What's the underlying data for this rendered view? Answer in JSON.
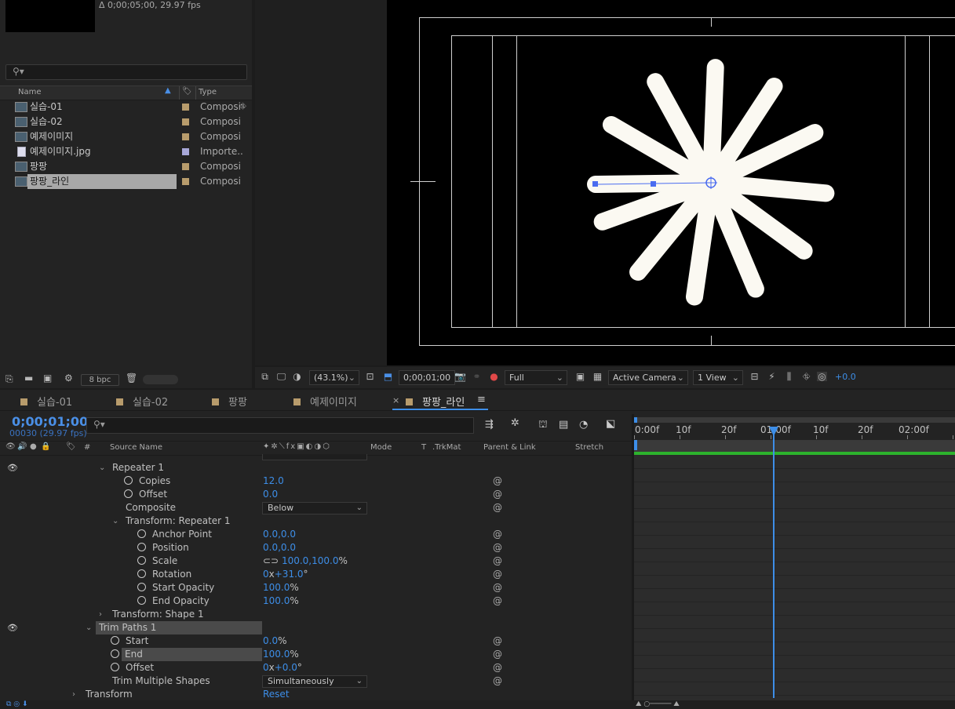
{
  "project": {
    "info": "Δ 0;00;05;00, 29.97 fps",
    "search_icon": "search-icon",
    "col_name": "Name",
    "col_type": "Type",
    "items": [
      {
        "name": "실습-01",
        "type": "Composi",
        "kind": "comp"
      },
      {
        "name": "실습-02",
        "type": "Composi",
        "kind": "comp"
      },
      {
        "name": "예제이미지",
        "type": "Composi",
        "kind": "comp"
      },
      {
        "name": "예제이미지.jpg",
        "type": "Importe..",
        "kind": "jpg"
      },
      {
        "name": "팡팡",
        "type": "Composi",
        "kind": "comp"
      },
      {
        "name": "팡팡_라인",
        "type": "Composi",
        "kind": "comp",
        "selected": true
      }
    ],
    "bpc": "8 bpc"
  },
  "viewer": {
    "zoom": "(43.1%)",
    "timecode": "0;00;01;00",
    "resolution": "Full",
    "camera": "Active Camera",
    "view": "1 View",
    "exposure": "+0.0"
  },
  "timeline": {
    "tabs": [
      "실습-01",
      "실습-02",
      "팡팡",
      "예제이미지",
      "팡팡_라인"
    ],
    "active_tab": "팡팡_라인",
    "timecode": "0;00;01;00",
    "frames": "00030 (29.97 fps)",
    "columns": {
      "hash": "#",
      "source": "Source Name",
      "mode": "Mode",
      "t": "T",
      "trkmat": ".TrkMat",
      "parent": "Parent & Link",
      "stretch": "Stretch"
    },
    "ruler": [
      "0:00f",
      "10f",
      "20f",
      "01:00f",
      "10f",
      "20f",
      "02:00f"
    ],
    "props": {
      "repeater": "Repeater 1",
      "copies_label": "Copies",
      "copies": "12.0",
      "offset_label": "Offset",
      "offset": "0.0",
      "composite_label": "Composite",
      "composite": "Below",
      "tr_repeater": "Transform: Repeater 1",
      "anchor_label": "Anchor Point",
      "anchor": "0.0,0.0",
      "position_label": "Position",
      "position": "0.0,0.0",
      "scale_label": "Scale",
      "scale": "100.0,100.0",
      "rotation_label": "Rotation",
      "rotation_x": "0",
      "rotation_deg": "+31.0",
      "start_op_label": "Start Opacity",
      "start_op": "100.0",
      "end_op_label": "End Opacity",
      "end_op": "100.0",
      "tr_shape": "Transform: Shape 1",
      "trim": "Trim Paths 1",
      "start_label": "Start",
      "start": "0.0",
      "end_label": "End",
      "end": "100.0",
      "toffset_label": "Offset",
      "toffset_x": "0",
      "toffset_deg": "+0.0",
      "multi_label": "Trim Multiple Shapes",
      "multi": "Simultaneously",
      "transform_label": "Transform",
      "reset": "Reset",
      "percent": "%",
      "x_sep": "x",
      "deg": "°"
    }
  },
  "colors": {
    "accent": "#3d8ee8",
    "comp_swatch": "#b89c6c",
    "bar_green": "#2db32d"
  }
}
